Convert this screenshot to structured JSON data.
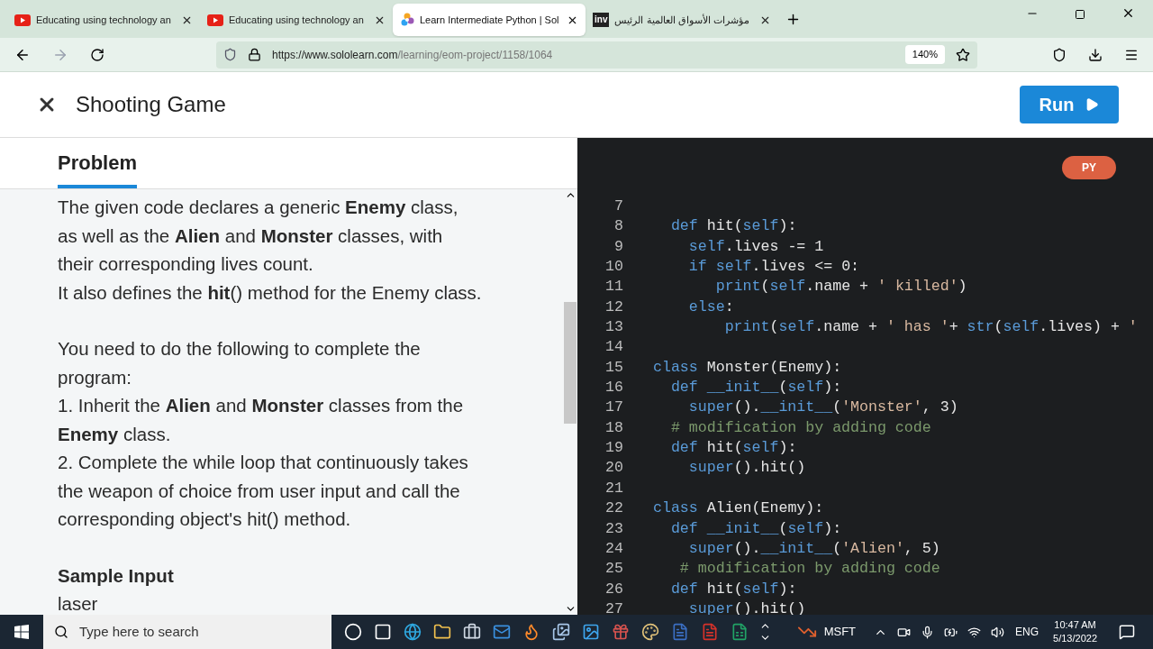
{
  "browser": {
    "tabs": [
      {
        "title": "Educating using technology an",
        "kind": "video",
        "selected": false
      },
      {
        "title": "Educating using technology an",
        "kind": "video",
        "selected": false
      },
      {
        "title": "Learn Intermediate Python | Sol",
        "kind": "swirl",
        "selected": true
      },
      {
        "title": "مؤشرات الأسواق العالمية الرئيس",
        "kind": "badge",
        "icon_text": "inv",
        "selected": false
      }
    ],
    "url_host": "https://www.sololearn.com",
    "url_path": "/learning/eom-project/1158/1064",
    "zoom": "140%"
  },
  "header": {
    "title": "Shooting Game",
    "run_button": "Run"
  },
  "problem": {
    "tab": {
      "label": "Problem",
      "selected": true
    },
    "blocks": [
      {
        "kind": "text",
        "text": "The given code declares a generic **Enemy** class, as well as the **Alien** and **Monster** classes, with their corresponding lives count."
      },
      {
        "kind": "text",
        "text": "It also defines the **hit**() method for the Enemy class."
      },
      {
        "kind": "gap"
      },
      {
        "kind": "text",
        "text": "You need to do the following to complete the program:"
      },
      {
        "kind": "text",
        "text": "1. Inherit the **Alien** and **Monster** classes from the **Enemy** class."
      },
      {
        "kind": "text",
        "text": "2. Complete the while loop that continuously takes the weapon of choice from user input and call the corresponding object's hit() method."
      },
      {
        "kind": "gap"
      },
      {
        "kind": "heading",
        "text": "Sample Input"
      },
      {
        "kind": "text",
        "text": "laser"
      }
    ]
  },
  "editor": {
    "language": "PY",
    "lines": [
      {
        "number": "7"
      },
      {
        "number": "8",
        "tokens": [
          {
            "kind": "keyword",
            "text": "  def"
          },
          {
            "kind": "text",
            "text": " hit("
          },
          {
            "kind": "keyword",
            "text": "self"
          },
          {
            "kind": "text",
            "text": "):"
          }
        ]
      },
      {
        "number": "9",
        "tokens": [
          {
            "kind": "keyword",
            "text": "    self"
          },
          {
            "kind": "text",
            "text": ".lives -= 1"
          }
        ]
      },
      {
        "number": "10",
        "tokens": [
          {
            "kind": "keyword",
            "text": "    if self"
          },
          {
            "kind": "text",
            "text": ".lives <= 0:"
          }
        ]
      },
      {
        "number": "11",
        "tokens": [
          {
            "kind": "keyword",
            "text": "       print"
          },
          {
            "kind": "text",
            "text": "("
          },
          {
            "kind": "keyword",
            "text": "self"
          },
          {
            "kind": "text",
            "text": ".name + "
          },
          {
            "kind": "string",
            "text": "' killed'"
          },
          {
            "kind": "text",
            "text": ")"
          }
        ]
      },
      {
        "number": "12",
        "tokens": [
          {
            "kind": "keyword",
            "text": "    else"
          },
          {
            "kind": "text",
            "text": ":"
          }
        ]
      },
      {
        "number": "13",
        "tokens": [
          {
            "kind": "keyword",
            "text": "        print"
          },
          {
            "kind": "text",
            "text": "("
          },
          {
            "kind": "keyword",
            "text": "self"
          },
          {
            "kind": "text",
            "text": ".name + "
          },
          {
            "kind": "string",
            "text": "' has '"
          },
          {
            "kind": "text",
            "text": "+ "
          },
          {
            "kind": "keyword",
            "text": "str"
          },
          {
            "kind": "text",
            "text": "("
          },
          {
            "kind": "keyword",
            "text": "self"
          },
          {
            "kind": "text",
            "text": ".lives) + "
          },
          {
            "kind": "string",
            "text": "'"
          }
        ]
      },
      {
        "number": "14"
      },
      {
        "number": "15",
        "tokens": [
          {
            "kind": "keyword",
            "text": "class"
          },
          {
            "kind": "text",
            "text": " Monster(Enemy):"
          }
        ]
      },
      {
        "number": "16",
        "tokens": [
          {
            "kind": "keyword",
            "text": "  def __init__"
          },
          {
            "kind": "text",
            "text": "("
          },
          {
            "kind": "keyword",
            "text": "self"
          },
          {
            "kind": "text",
            "text": "):"
          }
        ]
      },
      {
        "number": "17",
        "tokens": [
          {
            "kind": "keyword",
            "text": "    super"
          },
          {
            "kind": "text",
            "text": "()."
          },
          {
            "kind": "keyword",
            "text": "__init__"
          },
          {
            "kind": "text",
            "text": "("
          },
          {
            "kind": "string",
            "text": "'Monster'"
          },
          {
            "kind": "text",
            "text": ", 3)"
          }
        ]
      },
      {
        "number": "18",
        "tokens": [
          {
            "kind": "comment",
            "text": "  # modification by adding code"
          }
        ]
      },
      {
        "number": "19",
        "tokens": [
          {
            "kind": "keyword",
            "text": "  def"
          },
          {
            "kind": "text",
            "text": " hit("
          },
          {
            "kind": "keyword",
            "text": "self"
          },
          {
            "kind": "text",
            "text": "):"
          }
        ]
      },
      {
        "number": "20",
        "tokens": [
          {
            "kind": "keyword",
            "text": "    super"
          },
          {
            "kind": "text",
            "text": "().hit()"
          }
        ]
      },
      {
        "number": "21"
      },
      {
        "number": "22",
        "tokens": [
          {
            "kind": "keyword",
            "text": "class"
          },
          {
            "kind": "text",
            "text": " Alien(Enemy):"
          }
        ]
      },
      {
        "number": "23",
        "tokens": [
          {
            "kind": "keyword",
            "text": "  def __init__"
          },
          {
            "kind": "text",
            "text": "("
          },
          {
            "kind": "keyword",
            "text": "self"
          },
          {
            "kind": "text",
            "text": "):"
          }
        ]
      },
      {
        "number": "24",
        "tokens": [
          {
            "kind": "keyword",
            "text": "    super"
          },
          {
            "kind": "text",
            "text": "()."
          },
          {
            "kind": "keyword",
            "text": "__init__"
          },
          {
            "kind": "text",
            "text": "("
          },
          {
            "kind": "string",
            "text": "'Alien'"
          },
          {
            "kind": "text",
            "text": ", 5)"
          }
        ]
      },
      {
        "number": "25",
        "tokens": [
          {
            "kind": "comment",
            "text": "   # modification by adding code"
          }
        ]
      },
      {
        "number": "26",
        "tokens": [
          {
            "kind": "keyword",
            "text": "  def"
          },
          {
            "kind": "text",
            "text": " hit("
          },
          {
            "kind": "keyword",
            "text": "self"
          },
          {
            "kind": "text",
            "text": "):"
          }
        ]
      },
      {
        "number": "27",
        "tokens": [
          {
            "kind": "keyword",
            "text": "    super"
          },
          {
            "kind": "text",
            "text": "().hit()"
          }
        ]
      }
    ]
  },
  "taskbar": {
    "search_placeholder": "Type here to search",
    "apps": [
      {
        "kind": "circle"
      },
      {
        "kind": "taskview"
      },
      {
        "kind": "edge"
      },
      {
        "kind": "folder"
      },
      {
        "kind": "briefcase"
      },
      {
        "kind": "mail"
      },
      {
        "kind": "firefox"
      },
      {
        "kind": "photos"
      },
      {
        "kind": "image"
      },
      {
        "kind": "gift"
      },
      {
        "kind": "paint"
      },
      {
        "kind": "word"
      },
      {
        "kind": "pdf"
      },
      {
        "kind": "excel"
      }
    ],
    "stock": "MSFT",
    "language": "ENG",
    "time": "10:47 AM",
    "date": "5/13/2022"
  }
}
